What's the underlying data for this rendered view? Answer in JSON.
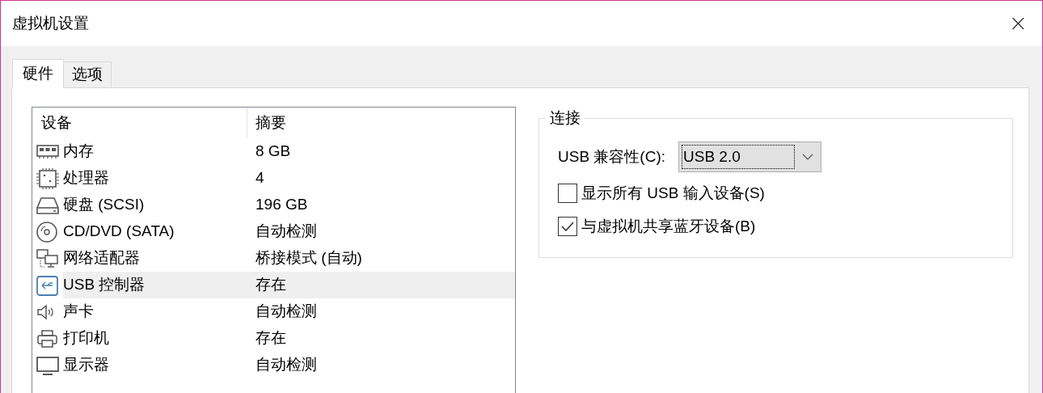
{
  "window": {
    "title": "虚拟机设置",
    "close": "×"
  },
  "tabs": [
    {
      "label": "硬件",
      "selected": true
    },
    {
      "label": "选项",
      "selected": false
    }
  ],
  "device_list": {
    "columns": [
      "设备",
      "摘要"
    ],
    "rows": [
      {
        "kind": "memory",
        "device": "内存",
        "summary": "8 GB",
        "selected": false
      },
      {
        "kind": "cpu",
        "device": "处理器",
        "summary": "4",
        "selected": false
      },
      {
        "kind": "disk",
        "device": "硬盘 (SCSI)",
        "summary": "196 GB",
        "selected": false
      },
      {
        "kind": "cd",
        "device": "CD/DVD (SATA)",
        "summary": "自动检测",
        "selected": false
      },
      {
        "kind": "network",
        "device": "网络适配器",
        "summary": "桥接模式 (自动)",
        "selected": false
      },
      {
        "kind": "usb",
        "device": "USB 控制器",
        "summary": "存在",
        "selected": true
      },
      {
        "kind": "sound",
        "device": "声卡",
        "summary": "自动检测",
        "selected": false
      },
      {
        "kind": "printer",
        "device": "打印机",
        "summary": "存在",
        "selected": false
      },
      {
        "kind": "display",
        "device": "显示器",
        "summary": "自动检测",
        "selected": false
      }
    ]
  },
  "connection": {
    "title": "连接",
    "compat_label": "USB 兼容性(C):",
    "compat_value": "USB 2.0",
    "options": [
      {
        "label": "显示所有 USB 输入设备(S)",
        "checked": false
      },
      {
        "label": "与虚拟机共享蓝牙设备(B)",
        "checked": true
      }
    ]
  }
}
